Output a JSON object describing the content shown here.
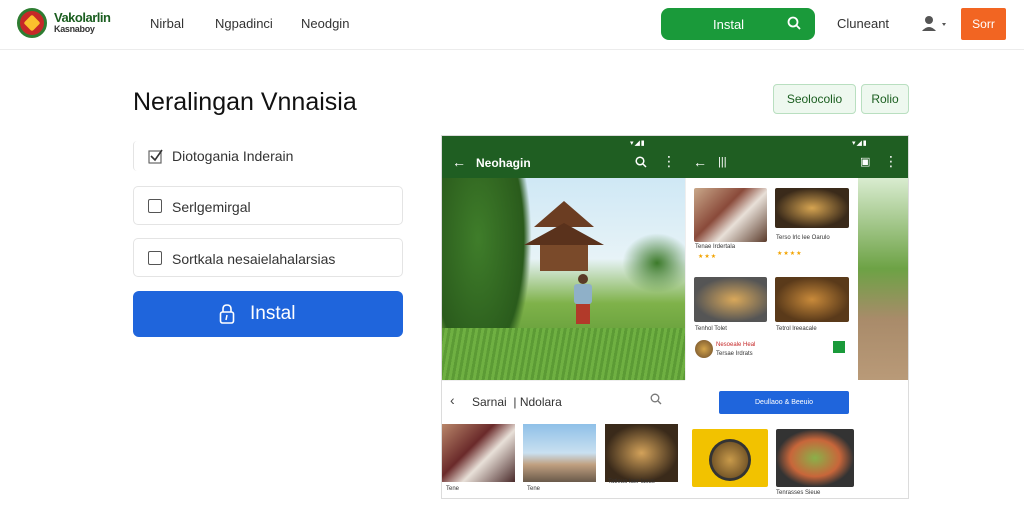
{
  "header": {
    "brand_top": "Vakolarlin",
    "brand_bottom": "Kasnaboy",
    "nav": [
      "Nirbal",
      "Ngpadinci",
      "Neodgin"
    ],
    "install_label": "Instal",
    "connect_label": "Cluneant",
    "orange_label": "Sorr"
  },
  "main": {
    "title": "Neralingan Vnnaisia",
    "options": [
      "Diotogania Inderain",
      "Serlgemirgal",
      "Sortkala nesaielahalarsias"
    ],
    "install_label": "Instal"
  },
  "pills": [
    "Seolocolio",
    "Rolio"
  ],
  "phone": {
    "appbar_title": "Neohagin",
    "sub_title": "Sarnai",
    "sub_title2": "Ndolara",
    "cta_label": "Deullaoo & Beeuio",
    "captions": [
      "Tenae Irdertala",
      "Terso Irlc lee Oarulo",
      "Tenhol Tolet",
      "Tetrol lreeacale",
      "Nesoeale Heal",
      "Tersae Irdrats",
      "Tene",
      "Tatieuo laer lasus",
      "Tenrasses Sieue"
    ]
  },
  "colors": {
    "brand_green": "#1a9a3a",
    "primary_blue": "#1f65dc",
    "accent_orange": "#f26522",
    "appbar_green": "#1f5e22"
  }
}
